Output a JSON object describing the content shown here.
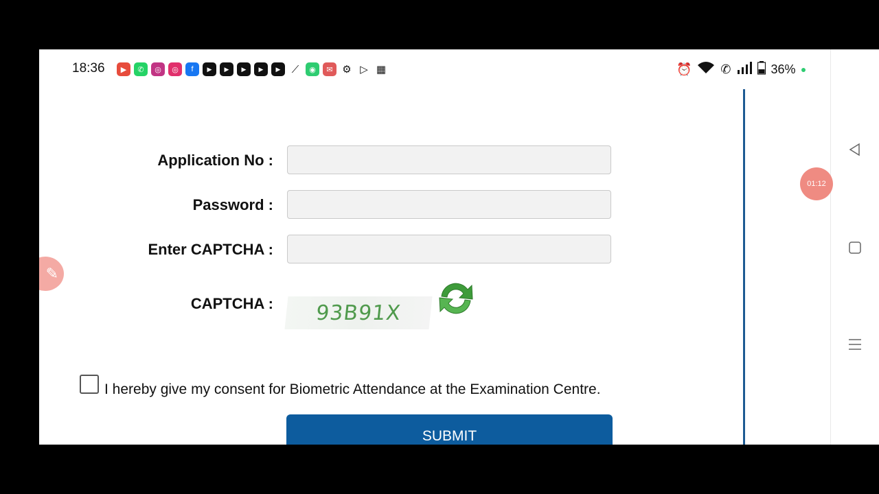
{
  "status_bar": {
    "time": "18:36",
    "battery": "36%",
    "app_icons": [
      {
        "name": "recorder-icon",
        "glyph": "▶",
        "color": "#e74c3c"
      },
      {
        "name": "whatsapp-icon",
        "glyph": "✆",
        "color": "#25d366"
      },
      {
        "name": "instagram-icon",
        "glyph": "◎",
        "color": "#c13584"
      },
      {
        "name": "instagram-icon",
        "glyph": "◎",
        "color": "#e1306c"
      },
      {
        "name": "facebook-icon",
        "glyph": "f",
        "color": "#1877f2"
      },
      {
        "name": "youtube-icon",
        "glyph": "▶",
        "color": "#111111"
      },
      {
        "name": "youtube-icon",
        "glyph": "▶",
        "color": "#111111"
      },
      {
        "name": "youtube-icon",
        "glyph": "▶",
        "color": "#111111"
      },
      {
        "name": "youtube-icon",
        "glyph": "▶",
        "color": "#111111"
      },
      {
        "name": "youtube-icon",
        "glyph": "▶",
        "color": "#111111"
      },
      {
        "name": "app-icon",
        "glyph": "⟋",
        "color": "#111111"
      },
      {
        "name": "chat-icon",
        "glyph": "◉",
        "color": "#2ecc71"
      },
      {
        "name": "mail-icon",
        "glyph": "✉",
        "color": "#e05a5a"
      },
      {
        "name": "gear-icon",
        "glyph": "⚙",
        "color": "#111111"
      },
      {
        "name": "play-store-icon",
        "glyph": "▷",
        "color": "#111111"
      },
      {
        "name": "calendar-icon",
        "glyph": "▦",
        "color": "#111111"
      }
    ]
  },
  "floating": {
    "timer": "01:12"
  },
  "form": {
    "application_no_label": "Application No :",
    "password_label": "Password :",
    "enter_captcha_label": "Enter CAPTCHA :",
    "captcha_label": "CAPTCHA :",
    "captcha_value": "93B91X",
    "application_no_value": "",
    "password_value": "",
    "captcha_input_value": ""
  },
  "consent": {
    "text": "I hereby give my consent for Biometric Attendance at the Examination Centre."
  },
  "submit": {
    "label": "SUBMIT"
  },
  "colors": {
    "accent": "#0d5c9e",
    "divider": "#1d5a92"
  }
}
